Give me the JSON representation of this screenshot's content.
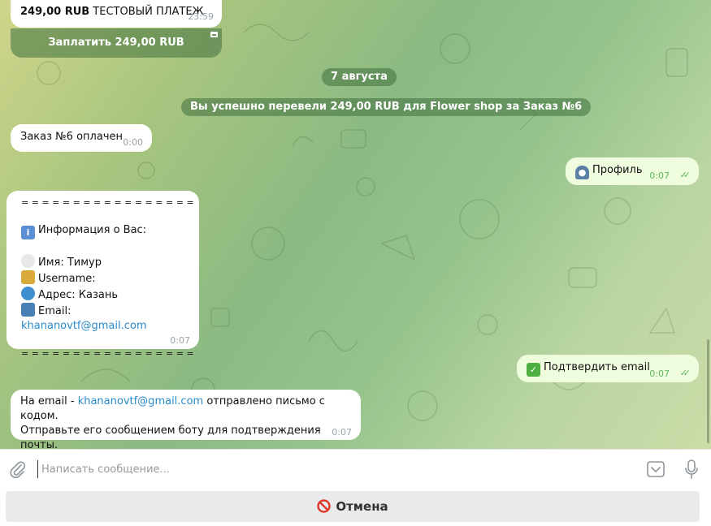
{
  "payment": {
    "amount_bold": "249,00 RUB",
    "label": " ТЕСТОВЫЙ ПЛАТЕЖ",
    "time": "23:59",
    "pay_button": "Заплатить 249,00 RUB"
  },
  "date_separator": "7 августа",
  "service_message": "Вы успешно перевели 249,00 RUB для Flower shop за Заказ №6",
  "messages": {
    "order_paid": {
      "text": "Заказ №6 оплачен",
      "time": "0:00"
    },
    "profile_cmd": {
      "emoji": "bust-in-silhouette",
      "text": "Профиль",
      "time": "0:07"
    },
    "profile_info": {
      "separator": "= = = = = = = = = = = = = = = = =",
      "info_header": "Информация о Вас:",
      "name": "Имя: Тимур",
      "username": "Username:",
      "address": "Адрес: Казань",
      "email_label": "Email: ",
      "email": "khananovtf@gmail.com",
      "separator_bottom": "= = = = = = = = = = = = = = = = =",
      "time": "0:07",
      "icons": [
        "information-icon",
        "speech-balloon-icon",
        "lock-with-key-icon",
        "globe-icon",
        "mailbox-icon"
      ]
    },
    "confirm_email_cmd": {
      "text": "Подтвердить email",
      "time": "0:07"
    },
    "email_sent": {
      "prefix": "На email - ",
      "email": "khananovtf@gmail.com",
      "suffix": " отправлено письмо с кодом.",
      "line2": "Отправьте его сообщением боту для подтверждения почты.",
      "time": "0:07"
    }
  },
  "composer": {
    "placeholder": "Написать сообщение..."
  },
  "keyboard": {
    "cancel_label": "Отмена"
  },
  "colors": {
    "outgoing_bubble": "#effdde",
    "incoming_bubble": "#ffffff",
    "link": "#2a8bcb",
    "read_check": "#5fb85a"
  }
}
